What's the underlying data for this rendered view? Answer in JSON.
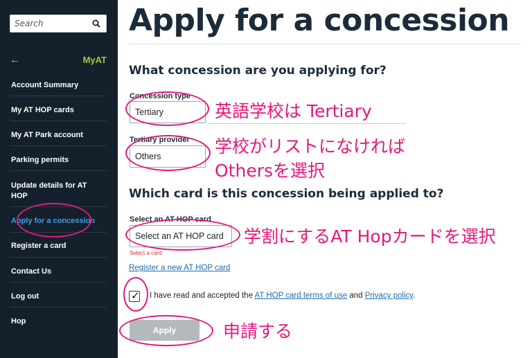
{
  "sidebar": {
    "search_placeholder": "Search",
    "back_label": "MyAT",
    "items": [
      {
        "label": "Account Summary"
      },
      {
        "label": "My AT HOP cards"
      },
      {
        "label": "My AT Park account"
      },
      {
        "label": "Parking permits"
      },
      {
        "label": "Update details for AT HOP"
      },
      {
        "label": "Apply for a concession",
        "active": true
      },
      {
        "label": "Register a card"
      },
      {
        "label": "Contact Us"
      },
      {
        "label": "Log out"
      },
      {
        "label": "Hop"
      }
    ]
  },
  "main": {
    "title": "Apply for a concession",
    "section1_heading": "What concession are you applying for?",
    "concession_type": {
      "label": "Concession type",
      "value": "Tertiary"
    },
    "tertiary_provider": {
      "label": "Tertiary provider",
      "value": "Others"
    },
    "section2_heading": "Which card is this concession being applied to?",
    "card_select": {
      "label": "Select an AT HOP card",
      "value": "Select an AT HOP card",
      "error": "Select a card"
    },
    "register_link": "Register a new AT HOP card",
    "terms": {
      "checked": true,
      "prefix": "I have read and accepted the",
      "terms_link": "AT HOP card terms of use",
      "and": "and",
      "privacy_link": "Privacy policy",
      "suffix": "."
    },
    "apply_button": "Apply"
  },
  "annotations": {
    "color": "#e4187c",
    "note1": "英語学校は Tertiary",
    "note2_line1": "学校がリストになければ",
    "note2_line2": "Othersを選択",
    "note3": "学割にするAT Hopカードを選択",
    "note4": "申請する"
  },
  "colors": {
    "sidebar_bg": "#14212d",
    "accent_green": "#9ccb3b",
    "active_link": "#3aa1e8",
    "link": "#1a6fb3",
    "error": "#d03030"
  }
}
